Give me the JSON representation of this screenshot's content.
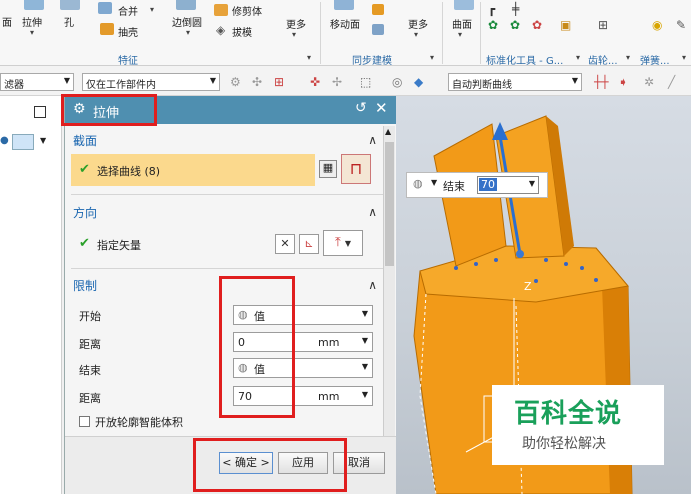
{
  "ribbon": {
    "items": {
      "face": "面",
      "extrude": "拉伸",
      "hole": "孔",
      "unite": "合并",
      "shell": "抽壳",
      "edge_blend": "边倒圆",
      "trim_body": "修剪体",
      "draft": "拔模",
      "more1": "更多",
      "move_face": "移动面",
      "more2": "更多",
      "surface": "曲面"
    },
    "groups": {
      "feature": "特征",
      "sync_modeling": "同步建模",
      "std_parts": "标准化工具 - G...",
      "gear": "齿轮...",
      "spring": "弹簧..."
    }
  },
  "toolbar": {
    "filter_label": "滤器",
    "scope_select": "仅在工作部件内",
    "curve_rule": "自动判断曲线"
  },
  "dialog": {
    "title": "拉伸",
    "section": {
      "header": "截面",
      "select_curve": "选择曲线 (8)"
    },
    "direction": {
      "header": "方向",
      "specify_vector": "指定矢量"
    },
    "limits": {
      "header": "限制",
      "start_label": "开始",
      "start_value": "值",
      "distance_label": "距离",
      "start_distance": "0",
      "end_label": "结束",
      "end_value": "值",
      "end_distance": "70",
      "unit": "mm",
      "open_profile": "开放轮廓智能体积"
    },
    "buttons": {
      "ok": "< 确定 >",
      "apply": "应用",
      "cancel": "取消"
    }
  },
  "viewport": {
    "end_label": "结束",
    "end_value": "70",
    "axis_label": "Z"
  },
  "watermark": {
    "main": "百科全说",
    "sub": "助你轻松解决"
  },
  "colors": {
    "part_orange": "#f29a18",
    "highlight_red": "#e01e1e",
    "title_blue": "#4f8fb0",
    "section_yellow": "#fbd98d",
    "watermark_green": "#1aa05a"
  }
}
